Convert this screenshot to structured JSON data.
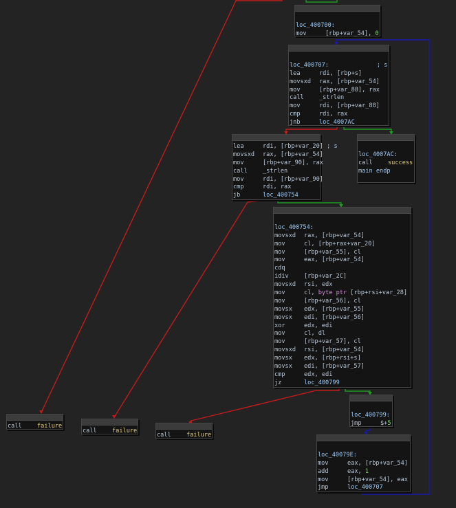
{
  "nodes": [
    {
      "key": "n400700",
      "lines": [
        {
          "label": "loc_400700:"
        },
        {
          "mnem": "mov",
          "ops": [
            {
              "t": "[rbp+var_54], "
            },
            {
              "t": "0",
              "c": "num"
            }
          ]
        }
      ]
    },
    {
      "key": "n400707",
      "lines": [
        {
          "label": "loc_400707:",
          "comment": "; s"
        },
        {
          "mnem": "lea",
          "ops": [
            {
              "t": "rdi, [rbp+s]"
            }
          ]
        },
        {
          "mnem": "movsxd",
          "ops": [
            {
              "t": "rax, [rbp+var_54]"
            }
          ]
        },
        {
          "mnem": "mov",
          "ops": [
            {
              "t": "[rbp+var_88], rax"
            }
          ]
        },
        {
          "mnem": "call",
          "ops": [
            {
              "t": "_strlen"
            }
          ]
        },
        {
          "mnem": "mov",
          "ops": [
            {
              "t": "rdi, [rbp+var_88]"
            }
          ]
        },
        {
          "mnem": "cmp",
          "ops": [
            {
              "t": "rdi, rax"
            }
          ]
        },
        {
          "mnem": "jnb",
          "ops": [
            {
              "t": "loc_4007AC",
              "c": "lbl"
            }
          ]
        }
      ]
    },
    {
      "key": "nblock2",
      "lines": [
        {
          "mnem": "lea",
          "ops": [
            {
              "t": "rdi, [rbp+var_20] "
            },
            {
              "t": "; s",
              "c": "cmt"
            }
          ]
        },
        {
          "mnem": "movsxd",
          "ops": [
            {
              "t": "rax, [rbp+var_54]"
            }
          ]
        },
        {
          "mnem": "mov",
          "ops": [
            {
              "t": "[rbp+var_90], rax"
            }
          ]
        },
        {
          "mnem": "call",
          "ops": [
            {
              "t": "_strlen"
            }
          ]
        },
        {
          "mnem": "mov",
          "ops": [
            {
              "t": "rdi, [rbp+var_90]"
            }
          ]
        },
        {
          "mnem": "cmp",
          "ops": [
            {
              "t": "rdi, rax"
            }
          ]
        },
        {
          "mnem": "jb",
          "ops": [
            {
              "t": "loc_400754",
              "c": "lbl"
            }
          ]
        }
      ]
    },
    {
      "key": "n4007AC",
      "lines": [
        {
          "label": "loc_4007AC:"
        },
        {
          "mnem": "call",
          "ops": [
            {
              "t": "success",
              "c": "fn"
            }
          ]
        },
        {
          "raw": "main endp"
        }
      ]
    },
    {
      "key": "n400754",
      "lines": [
        {
          "label": "loc_400754:"
        },
        {
          "mnem": "movsxd",
          "ops": [
            {
              "t": "rax, [rbp+var_54]"
            }
          ]
        },
        {
          "mnem": "mov",
          "ops": [
            {
              "t": "cl, [rbp+rax+var_20]"
            }
          ]
        },
        {
          "mnem": "mov",
          "ops": [
            {
              "t": "[rbp+var_55], cl"
            }
          ]
        },
        {
          "mnem": "mov",
          "ops": [
            {
              "t": "eax, [rbp+var_54]"
            }
          ]
        },
        {
          "mnem": "cdq",
          "ops": []
        },
        {
          "mnem": "idiv",
          "ops": [
            {
              "t": "[rbp+var_2C]"
            }
          ]
        },
        {
          "mnem": "movsxd",
          "ops": [
            {
              "t": "rsi, edx"
            }
          ]
        },
        {
          "mnem": "mov",
          "ops": [
            {
              "t": "cl, "
            },
            {
              "t": "byte ptr",
              "c": "ptr"
            },
            {
              "t": " [rbp+rsi+var_28]"
            }
          ]
        },
        {
          "mnem": "mov",
          "ops": [
            {
              "t": "[rbp+var_56], cl"
            }
          ]
        },
        {
          "mnem": "movsx",
          "ops": [
            {
              "t": "edx, [rbp+var_55]"
            }
          ]
        },
        {
          "mnem": "movsx",
          "ops": [
            {
              "t": "edi, [rbp+var_56]"
            }
          ]
        },
        {
          "mnem": "xor",
          "ops": [
            {
              "t": "edx, edi"
            }
          ]
        },
        {
          "mnem": "mov",
          "ops": [
            {
              "t": "cl, dl"
            }
          ]
        },
        {
          "mnem": "mov",
          "ops": [
            {
              "t": "[rbp+var_57], cl"
            }
          ]
        },
        {
          "mnem": "movsxd",
          "ops": [
            {
              "t": "rsi, [rbp+var_54]"
            }
          ]
        },
        {
          "mnem": "movsx",
          "ops": [
            {
              "t": "edx, [rbp+rsi+s]"
            }
          ]
        },
        {
          "mnem": "movsx",
          "ops": [
            {
              "t": "edi, [rbp+var_57]"
            }
          ]
        },
        {
          "mnem": "cmp",
          "ops": [
            {
              "t": "edx, edi"
            }
          ]
        },
        {
          "mnem": "jz",
          "ops": [
            {
              "t": "loc_400799",
              "c": "lbl"
            }
          ]
        }
      ]
    },
    {
      "key": "n400799",
      "lines": [
        {
          "label": "loc_400799:"
        },
        {
          "mnem": "jmp",
          "ops": [
            {
              "t": "$+"
            },
            {
              "t": "5",
              "c": "num"
            }
          ]
        }
      ]
    },
    {
      "key": "n40079E",
      "lines": [
        {
          "label": "loc_40079E:"
        },
        {
          "mnem": "mov",
          "ops": [
            {
              "t": "eax, [rbp+var_54]"
            }
          ]
        },
        {
          "mnem": "add",
          "ops": [
            {
              "t": "eax, "
            },
            {
              "t": "1",
              "c": "num"
            }
          ]
        },
        {
          "mnem": "mov",
          "ops": [
            {
              "t": "[rbp+var_54], eax"
            }
          ]
        },
        {
          "mnem": "jmp",
          "ops": [
            {
              "t": "loc_400707",
              "c": "lbl"
            }
          ]
        }
      ]
    },
    {
      "key": "fail1",
      "lines": [
        {
          "mnem": "call",
          "ops": [
            {
              "t": "failure",
              "c": "fn"
            }
          ]
        }
      ]
    },
    {
      "key": "fail2",
      "lines": [
        {
          "mnem": "call",
          "ops": [
            {
              "t": "failure",
              "c": "fn"
            }
          ]
        }
      ]
    },
    {
      "key": "fail3",
      "lines": [
        {
          "mnem": "call",
          "ops": [
            {
              "t": "failure",
              "c": "fn"
            }
          ]
        }
      ]
    }
  ],
  "colors": {
    "background": "#232323",
    "edge_true": "#1f9a1f",
    "edge_false": "#c21b1b",
    "edge_loop": "#1a1aa8"
  }
}
